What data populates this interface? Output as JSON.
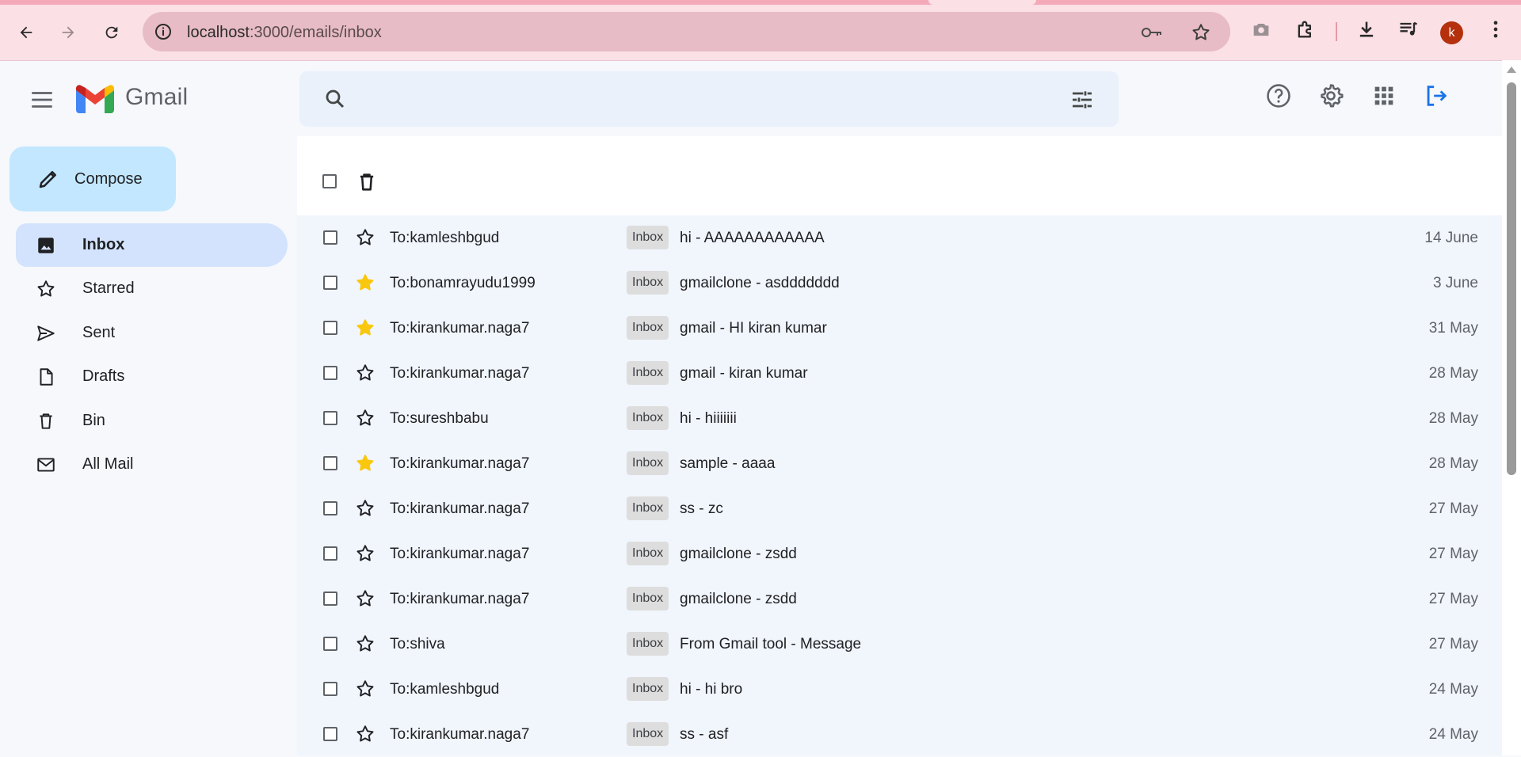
{
  "browser": {
    "url_host": "localhost",
    "url_path": ":3000/emails/inbox",
    "profile_initial": "k"
  },
  "app": {
    "logo_text": "Gmail",
    "search": {
      "placeholder": ""
    }
  },
  "sidebar": {
    "compose_label": "Compose",
    "items": [
      {
        "label": "Inbox",
        "icon": "photo-icon",
        "active": true
      },
      {
        "label": "Starred",
        "icon": "star-outline-icon"
      },
      {
        "label": "Sent",
        "icon": "send-icon"
      },
      {
        "label": "Drafts",
        "icon": "draft-icon"
      },
      {
        "label": "Bin",
        "icon": "trash-icon"
      },
      {
        "label": "All Mail",
        "icon": "mail-icon"
      }
    ]
  },
  "emails": [
    {
      "to": "To:kamleshbgud",
      "label": "Inbox",
      "subject": "hi - AAAAAAAAAAAA",
      "date": "14 June",
      "starred": false
    },
    {
      "to": "To:bonamrayudu1999",
      "label": "Inbox",
      "subject": "gmailclone - asddddddd",
      "date": "3 June",
      "starred": true
    },
    {
      "to": "To:kirankumar.naga7",
      "label": "Inbox",
      "subject": "gmail - HI kiran kumar",
      "date": "31 May",
      "starred": true
    },
    {
      "to": "To:kirankumar.naga7",
      "label": "Inbox",
      "subject": "gmail - kiran kumar",
      "date": "28 May",
      "starred": false
    },
    {
      "to": "To:sureshbabu",
      "label": "Inbox",
      "subject": "hi - hiiiiiii",
      "date": "28 May",
      "starred": false
    },
    {
      "to": "To:kirankumar.naga7",
      "label": "Inbox",
      "subject": "sample - aaaa",
      "date": "28 May",
      "starred": true
    },
    {
      "to": "To:kirankumar.naga7",
      "label": "Inbox",
      "subject": "ss - zc",
      "date": "27 May",
      "starred": false
    },
    {
      "to": "To:kirankumar.naga7",
      "label": "Inbox",
      "subject": "gmailclone - zsdd",
      "date": "27 May",
      "starred": false
    },
    {
      "to": "To:kirankumar.naga7",
      "label": "Inbox",
      "subject": "gmailclone - zsdd",
      "date": "27 May",
      "starred": false
    },
    {
      "to": "To:shiva",
      "label": "Inbox",
      "subject": "From Gmail tool - Message",
      "date": "27 May",
      "starred": false
    },
    {
      "to": "To:kamleshbgud",
      "label": "Inbox",
      "subject": "hi - hi bro",
      "date": "24 May",
      "starred": false
    },
    {
      "to": "To:kirankumar.naga7",
      "label": "Inbox",
      "subject": "ss - asf",
      "date": "24 May",
      "starred": false
    }
  ],
  "colors": {
    "star_filled": "#f9c80e",
    "star_outline": "#202124",
    "active_nav": "#d3e3fd",
    "compose_bg": "#c2e7ff"
  }
}
